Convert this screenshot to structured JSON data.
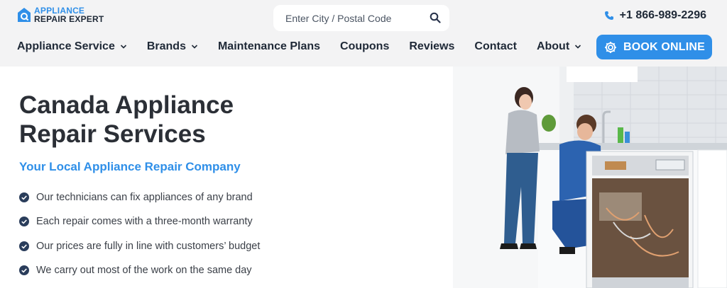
{
  "brand": {
    "line1": "APPLIANCE",
    "line2": "REPAIR EXPERT"
  },
  "search": {
    "placeholder": "Enter City / Postal Code",
    "value": ""
  },
  "phone": "+1 866-989-2296",
  "nav": [
    {
      "label": "Appliance Service",
      "dropdown": true
    },
    {
      "label": "Brands",
      "dropdown": true
    },
    {
      "label": "Maintenance Plans",
      "dropdown": false
    },
    {
      "label": "Coupons",
      "dropdown": false
    },
    {
      "label": "Reviews",
      "dropdown": false
    },
    {
      "label": "Contact",
      "dropdown": false
    },
    {
      "label": "About",
      "dropdown": true
    }
  ],
  "book_button": "BOOK ONLINE",
  "hero": {
    "title_line1": "Canada Appliance",
    "title_line2": "Repair Services",
    "subtitle": "Your Local Appliance Repair Company",
    "features": [
      "Our technicians can fix appliances of any brand",
      "Each repair comes with a three-month warranty",
      "Our prices are fully in line with customers’ budget",
      "We carry out most of the work on the same day"
    ]
  },
  "colors": {
    "accent": "#2f8fe8",
    "text_dark": "#2b2f36",
    "check": "#2a3d5b"
  },
  "icons": {
    "search": "search-icon",
    "phone": "phone-icon",
    "book": "gear-icon",
    "feature": "check-circle-icon",
    "dropdown": "chevron-down-icon"
  }
}
